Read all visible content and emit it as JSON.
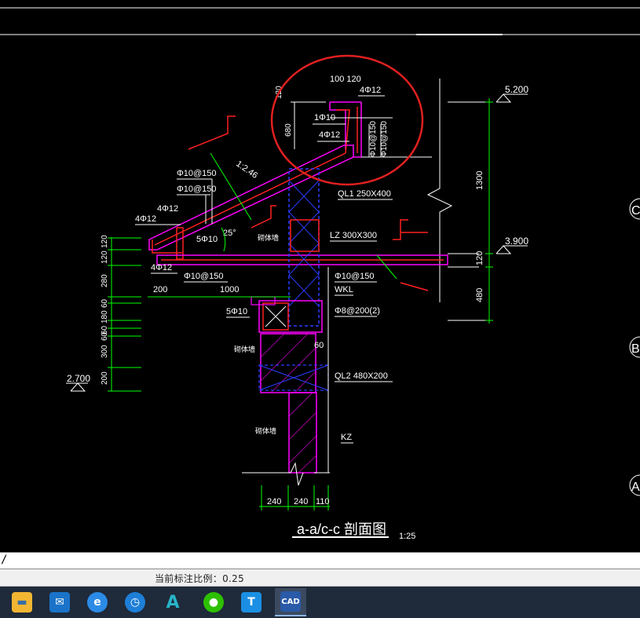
{
  "drawing": {
    "labels": {
      "dim_100_120": "100 120",
      "rebar_4phi12_top": "4Φ12",
      "dim_120_top": "120",
      "dim_680": "680",
      "rebar_1phi10": "1Φ10",
      "rebar_4phi12_mid": "4Φ12",
      "stirrup_right_1": "Φ10@150",
      "stirrup_right_2": "Φ10@150",
      "elev_5200": "5.200",
      "dim_1300": "1300",
      "slope_ratio": "1:2.46",
      "phi10_150_a": "Φ10@150",
      "phi10_150_b": "Φ10@150",
      "ql1": "QL1 250X400",
      "rebar_4phi12_left": "4Φ12",
      "rebar_4phi12_left2": "4Φ12",
      "rebar_5phi10": "5Φ10",
      "angle_25": "25°",
      "wall_label_1": "砌体墙",
      "lz": "LZ 300X300",
      "elev_3900": "3.900",
      "dim_120_right": "120",
      "rebar_4phi12_bottom": "4Φ12",
      "phi10_150_c": "Φ10@150",
      "phi10_150_d": "Φ10@150",
      "dim_1000": "1000",
      "dim_200": "200",
      "wkl": "WKL",
      "dim_480_right": "480",
      "rebar_5phi10_b": "5Φ10",
      "phi8_200": "Φ8@200(2)",
      "dim_60": "60",
      "wall_label_2": "砌体墙",
      "ql2": "QL2 480X200",
      "elev_2700": "2.700",
      "wall_label_3": "砌体墙",
      "kz": "KZ",
      "dim_240_a": "240",
      "dim_240_b": "240",
      "dim_110": "110",
      "section_title": "a-a/c-c 剖面图",
      "scale": "1:25",
      "left_dims": [
        "120",
        "120",
        "280",
        "60",
        "180",
        "60",
        "60",
        "300",
        "200"
      ],
      "grid_c": "C",
      "grid_b": "B",
      "grid_a": "A"
    },
    "colors": {
      "green": "#00ff00",
      "white": "#ffffff",
      "red": "#ff2020",
      "magenta": "#ff00ff",
      "blue": "#2a3cff",
      "highlight": "#e02020"
    }
  },
  "command_line": {
    "text": "/"
  },
  "status_bar": {
    "text": "当前标注比例：0.25"
  },
  "taskbar": {
    "items": [
      {
        "name": "file-explorer-icon",
        "glyph": "▬"
      },
      {
        "name": "mail-icon",
        "glyph": "✉"
      },
      {
        "name": "edge-browser-icon",
        "glyph": "e"
      },
      {
        "name": "clock-app-icon",
        "glyph": "◷"
      },
      {
        "name": "autocad-icon",
        "glyph": "A"
      },
      {
        "name": "wechat-icon",
        "glyph": "●"
      },
      {
        "name": "text-app-icon",
        "glyph": "T"
      },
      {
        "name": "cad-viewer-icon",
        "glyph": "CAD"
      }
    ]
  }
}
